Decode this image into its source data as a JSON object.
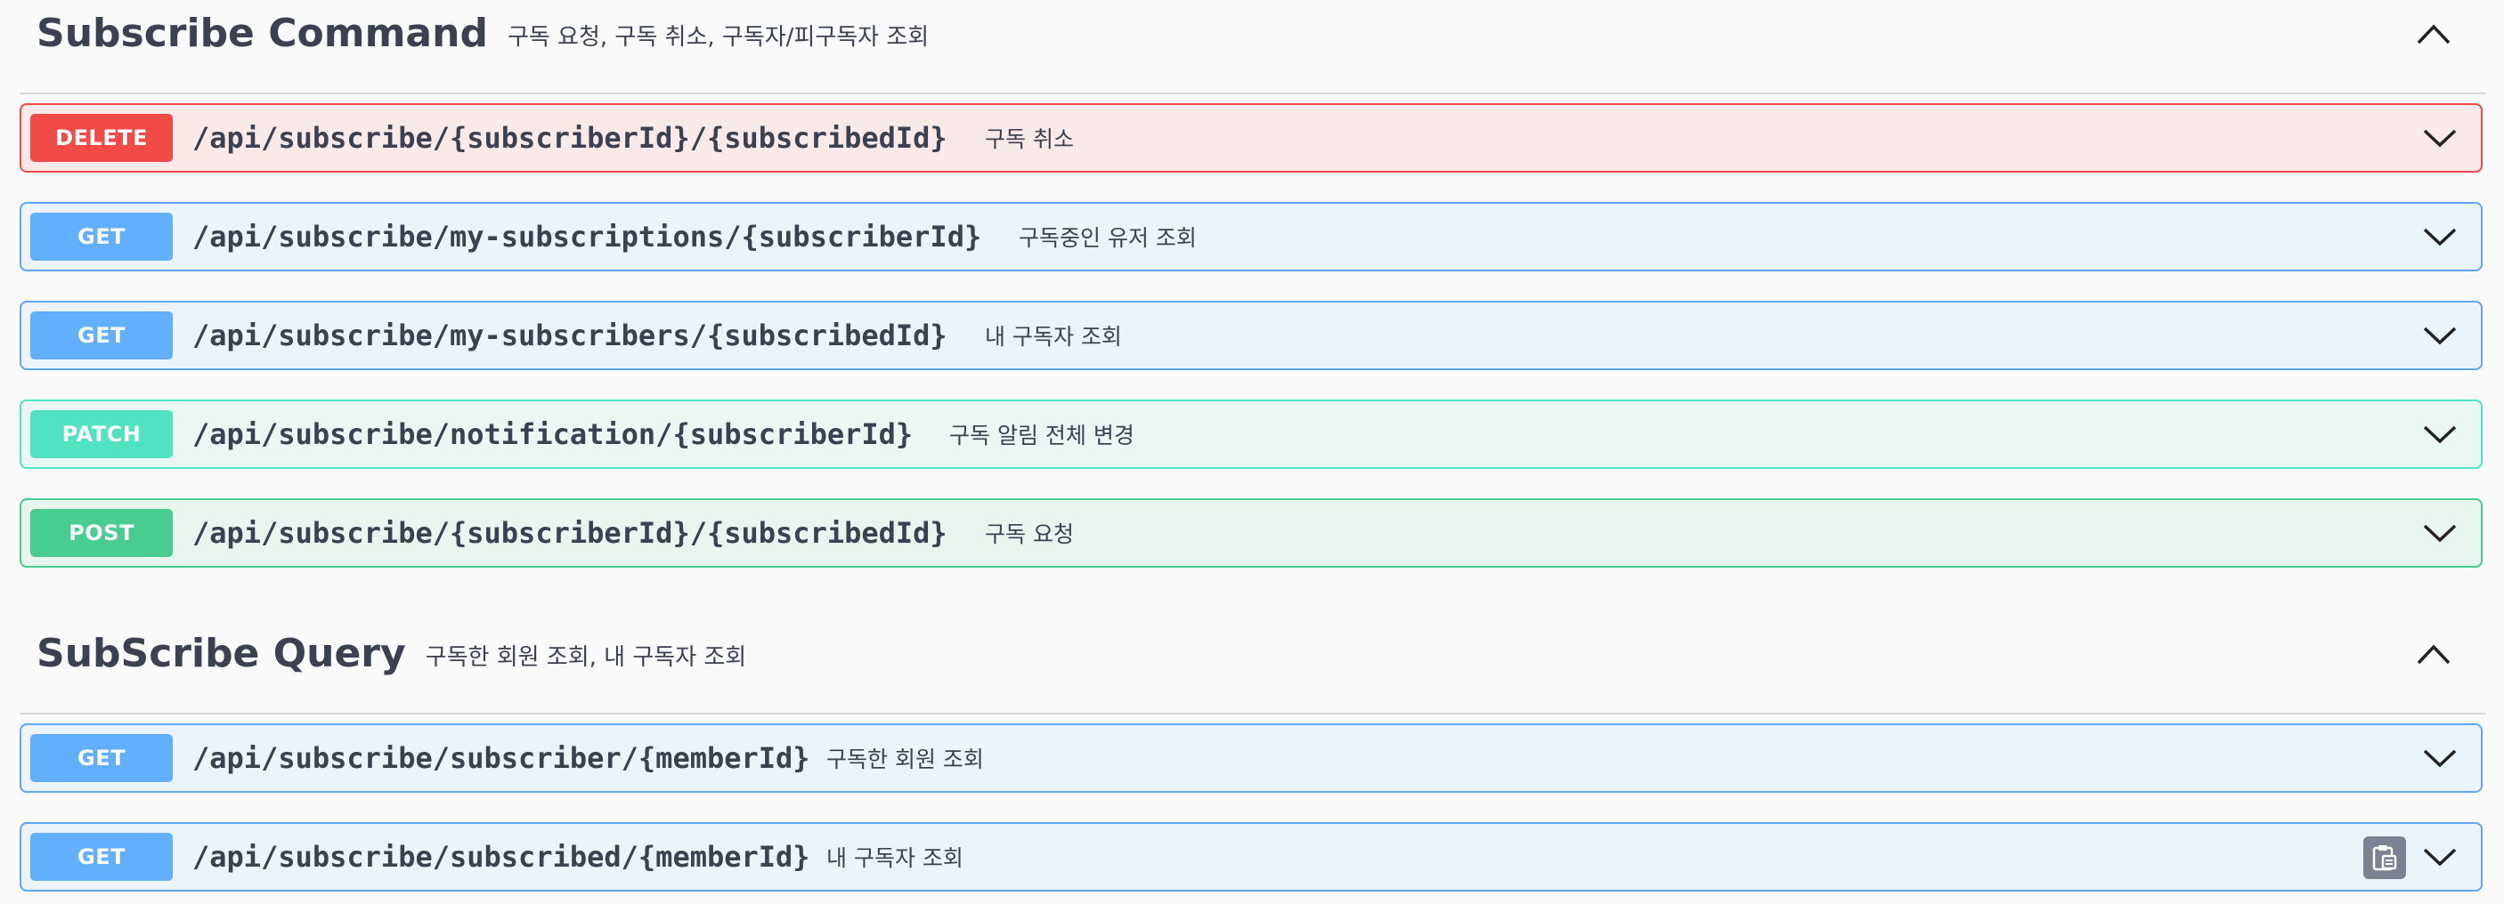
{
  "sections": [
    {
      "name": "Subscribe Command",
      "description": "구독 요청, 구독 취소, 구독자/피구독자 조회",
      "operations": [
        {
          "method": "DELETE",
          "path": "/api/subscribe/{subscriberId}/{subscribedId}",
          "summary": "구독 취소"
        },
        {
          "method": "GET",
          "path": "/api/subscribe/my-subscriptions/{subscriberId}",
          "summary": "구독중인 유저 조회"
        },
        {
          "method": "GET",
          "path": "/api/subscribe/my-subscribers/{subscribedId}",
          "summary": "내 구독자 조회"
        },
        {
          "method": "PATCH",
          "path": "/api/subscribe/notification/{subscriberId}",
          "summary": "구독 알림 전체 변경"
        },
        {
          "method": "POST",
          "path": "/api/subscribe/{subscriberId}/{subscribedId}",
          "summary": "구독 요청"
        }
      ]
    },
    {
      "name": "SubScribe Query",
      "description": "구독한 회원 조회, 내 구독자 조회",
      "operations": [
        {
          "method": "GET",
          "path": "/api/subscribe/subscriber/{memberId}",
          "summary": "구독한 회원 조회"
        },
        {
          "method": "GET",
          "path": "/api/subscribe/subscribed/{memberId}",
          "summary": "내 구독자 조회"
        }
      ]
    }
  ],
  "colors": {
    "delete": "#f24a47",
    "get": "#61affe",
    "patch": "#50e3c2",
    "post": "#49cc90",
    "text": "#3b4151"
  },
  "icons": {
    "section_toggle": "chevron-up-icon",
    "operation_toggle": "chevron-down-icon",
    "copy": "clipboard-icon"
  }
}
